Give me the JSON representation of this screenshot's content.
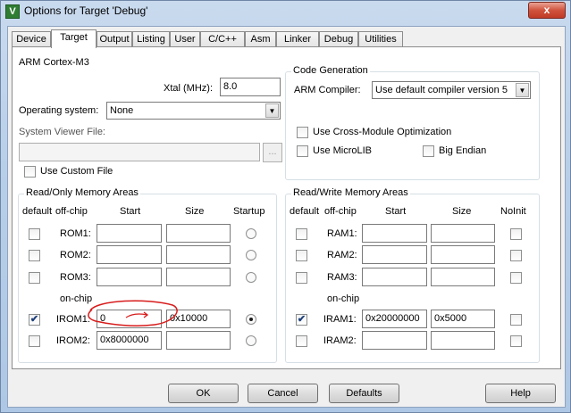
{
  "window": {
    "title": "Options for Target 'Debug'",
    "close_glyph": "x"
  },
  "tabs": [
    "Device",
    "Target",
    "Output",
    "Listing",
    "User",
    "C/C++",
    "Asm",
    "Linker",
    "Debug",
    "Utilities"
  ],
  "target": {
    "device_name": "ARM Cortex-M3",
    "xtal_label": "Xtal (MHz):",
    "xtal_value": "8.0",
    "os_label": "Operating system:",
    "os_value": "None",
    "svf_label": "System Viewer File:",
    "svf_value": "",
    "browse_label": "...",
    "custom_file_label": "Use Custom File"
  },
  "code_gen": {
    "title": "Code Generation",
    "compiler_label": "ARM Compiler:",
    "compiler_value": "Use default compiler version 5",
    "cross_module_label": "Use Cross-Module Optimization",
    "microlib_label": "Use MicroLIB",
    "big_endian_label": "Big Endian"
  },
  "rom": {
    "title": "Read/Only Memory Areas",
    "headers": {
      "default": "default",
      "offchip": "off-chip",
      "start": "Start",
      "size": "Size",
      "extra": "Startup"
    },
    "onchip_label": "on-chip",
    "rows": [
      {
        "name": "ROM1:",
        "start": "",
        "size": "",
        "checked": false,
        "selected": false
      },
      {
        "name": "ROM2:",
        "start": "",
        "size": "",
        "checked": false,
        "selected": false
      },
      {
        "name": "ROM3:",
        "start": "",
        "size": "",
        "checked": false,
        "selected": false
      },
      {
        "name": "IROM1:",
        "start": "0",
        "size": "0x10000",
        "checked": true,
        "selected": true
      },
      {
        "name": "IROM2:",
        "start": "0x8000000",
        "size": "",
        "checked": false,
        "selected": false
      }
    ]
  },
  "ram": {
    "title": "Read/Write Memory Areas",
    "headers": {
      "default": "default",
      "offchip": "off-chip",
      "start": "Start",
      "size": "Size",
      "extra": "NoInit"
    },
    "onchip_label": "on-chip",
    "rows": [
      {
        "name": "RAM1:",
        "start": "",
        "size": "",
        "checked": false
      },
      {
        "name": "RAM2:",
        "start": "",
        "size": "",
        "checked": false
      },
      {
        "name": "RAM3:",
        "start": "",
        "size": "",
        "checked": false
      },
      {
        "name": "IRAM1:",
        "start": "0x20000000",
        "size": "0x5000",
        "checked": true
      },
      {
        "name": "IRAM2:",
        "start": "",
        "size": "",
        "checked": false
      }
    ]
  },
  "buttons": {
    "ok": "OK",
    "cancel": "Cancel",
    "defaults": "Defaults",
    "help": "Help"
  },
  "glyphs": {
    "check": "✔",
    "dropdown": "▼"
  },
  "colors": {
    "annotation": "#d81c1c",
    "title_bar": "#b8cfe8",
    "close_button": "#c9442e"
  }
}
